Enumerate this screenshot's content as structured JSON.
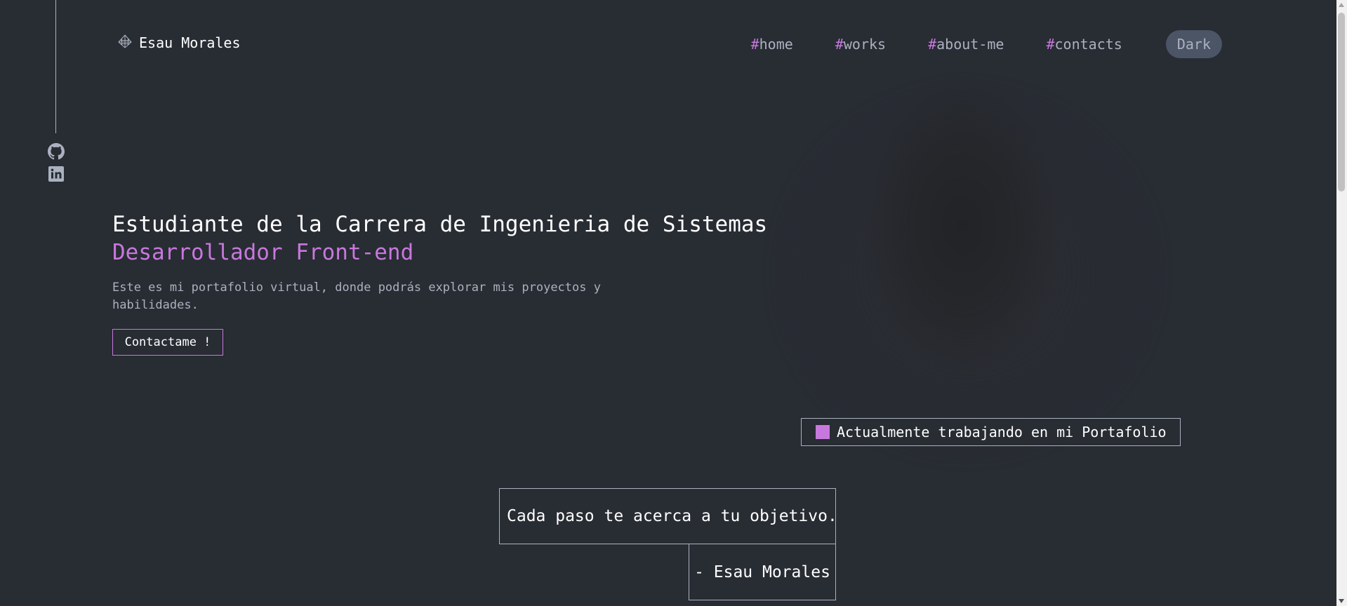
{
  "header": {
    "logo_name": "Esau Morales",
    "nav": [
      {
        "hash": "#",
        "label": "home"
      },
      {
        "hash": "#",
        "label": "works"
      },
      {
        "hash": "#",
        "label": "about-me"
      },
      {
        "hash": "#",
        "label": "contacts"
      }
    ],
    "theme_toggle": "Dark"
  },
  "social": {
    "icons": [
      "github-icon",
      "linkedin-icon"
    ]
  },
  "hero": {
    "title": "Estudiante de la Carrera de Ingenieria de Sistemas",
    "subtitle": "Desarrollador Front-end",
    "description": "Este es mi portafolio virtual, donde podrás explorar mis proyectos y habilidades.",
    "cta": "Contactame !",
    "status": "Actualmente trabajando en mi Portafolio"
  },
  "quote": {
    "text": "Cada paso te acerca a tu objetivo.",
    "author": "- Esau Morales"
  },
  "colors": {
    "background": "#282c33",
    "accent": "#c778dd",
    "muted_text": "#abb2bf",
    "toggle_bg": "#4b5565"
  }
}
